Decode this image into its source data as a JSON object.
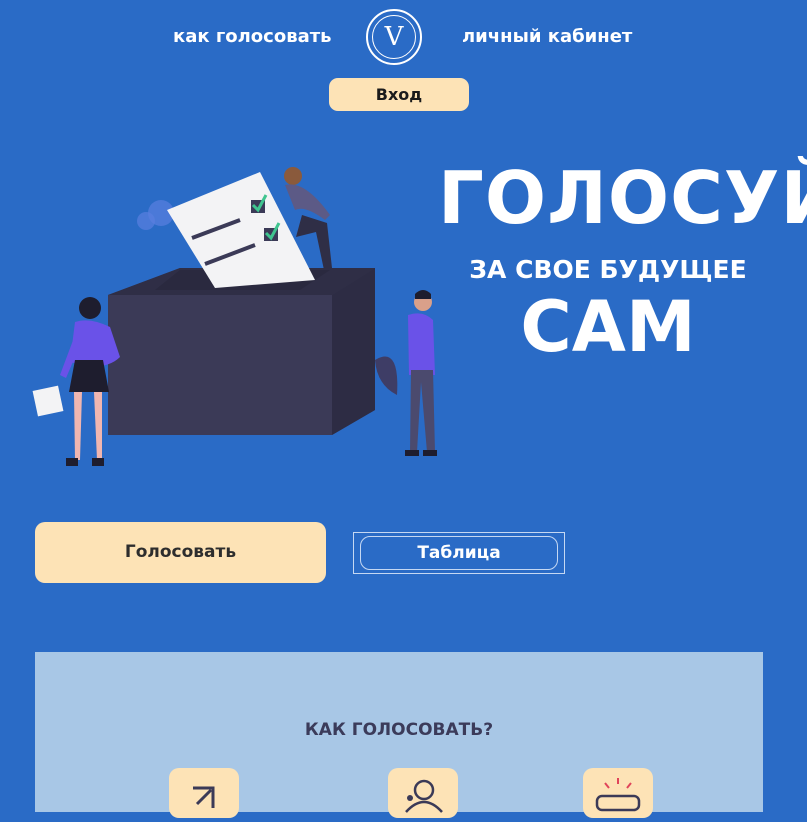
{
  "header": {
    "nav_how": "как голосовать",
    "nav_cabinet": "личный кабинет",
    "logo_letter": "V",
    "login_label": "Вход"
  },
  "hero": {
    "title": "ГОЛОСУЙ",
    "subtitle": "ЗА СВОЕ БУДУЩЕЕ",
    "big": "САМ"
  },
  "actions": {
    "vote_label": "Голосовать",
    "table_label": "Таблица"
  },
  "how": {
    "title": "КАК ГОЛОСОВАТЬ?",
    "steps": [
      {
        "icon": "enter-icon"
      },
      {
        "icon": "user-badge-icon"
      },
      {
        "icon": "alarm-icon"
      }
    ]
  },
  "colors": {
    "background": "#2a6bc6",
    "accent_button": "#fde3b6",
    "section_bg": "#a8c7e6"
  }
}
